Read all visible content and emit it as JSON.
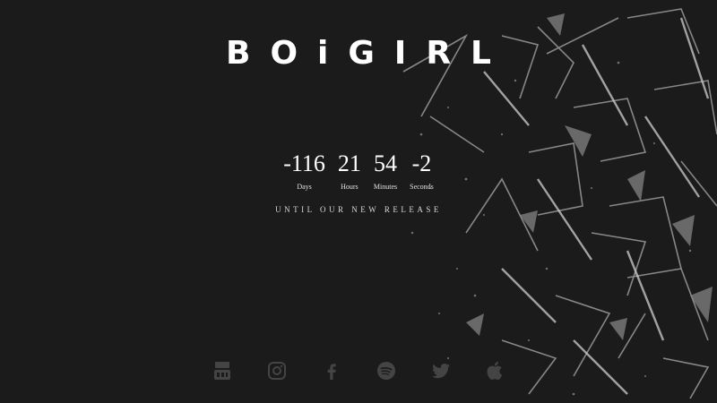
{
  "brand": {
    "logo_text": "BOiGIRL"
  },
  "countdown": [
    {
      "value": "-116",
      "label": "Days"
    },
    {
      "value": "21",
      "label": "Hours"
    },
    {
      "value": "54",
      "label": "Minutes"
    },
    {
      "value": "-2",
      "label": "Seconds"
    }
  ],
  "tagline": "UNTIL OUR NEW RELEASE",
  "social_icons": [
    "youtube-icon",
    "instagram-icon",
    "facebook-icon",
    "spotify-icon",
    "twitter-icon",
    "apple-icon"
  ],
  "colors": {
    "background": "#1b1b1b",
    "text": "#ffffff",
    "social_icon": "#444444"
  }
}
